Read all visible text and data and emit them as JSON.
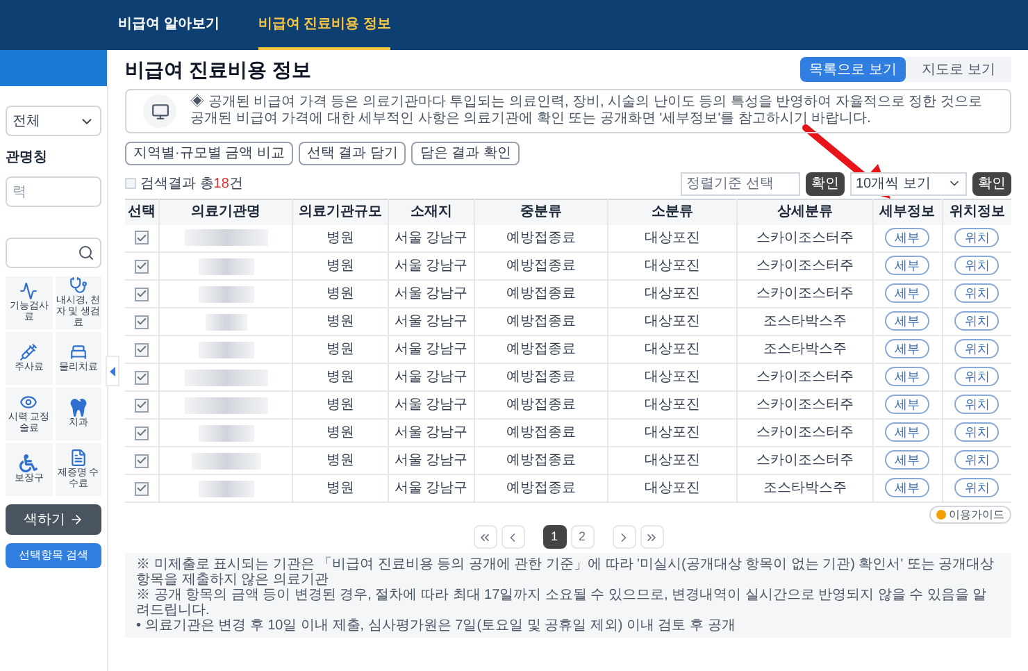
{
  "nav": {
    "tabs": [
      {
        "label": "비급여 알아보기",
        "selected": false
      },
      {
        "label": "비급여 진료비용 정보",
        "selected": true
      }
    ]
  },
  "sidebar": {
    "region_select": "전체",
    "name_label": "관명칭",
    "name_placeholder": "력",
    "categories": [
      {
        "label": "기능검사료",
        "kind": "pulse"
      },
      {
        "label": "내시경, 천자 및 생검료",
        "kind": "stethoscope"
      },
      {
        "label": "주사료",
        "kind": "syringe"
      },
      {
        "label": "물리치료",
        "kind": "bed"
      },
      {
        "label": "시력 교정술료",
        "kind": "eye"
      },
      {
        "label": "치과",
        "kind": "tooth"
      },
      {
        "label": "보장구",
        "kind": "wheelchair"
      },
      {
        "label": "제증명 수수료",
        "kind": "document"
      }
    ],
    "search_button": "색하기",
    "selected_search_button": "선택항목 검색"
  },
  "page": {
    "title": "비급여 진료비용 정보",
    "view_tabs": [
      {
        "label": "목록으로 보기",
        "selected": true
      },
      {
        "label": "지도로 보기",
        "selected": false
      }
    ],
    "notice": "◈ 공개된 비급여 가격 등은 의료기관마다 투입되는 의료인력, 장비, 시술의 난이도 등의 특성을 반영하여 자율적으로 정한 것으로 공개된 비급여 가격에 대한 세부적인 사항은 의료기관에 확인 또는 공개화면 '세부정보'를 참고하시기 바랍니다.",
    "actions": [
      "지역별·규모별 금액 비교",
      "선택 결과 담기",
      "담은 결과 확인"
    ],
    "result": {
      "prefix": "검색결과 총",
      "count": "18",
      "suffix": "건"
    },
    "sort_select": {
      "placeholder": "정렬기준 선택"
    },
    "sort_confirm": "확인",
    "page_size_select": "10개씩 보기",
    "page_size_confirm": "확인"
  },
  "table": {
    "columns": [
      "선택",
      "의료기관명",
      "의료기관규모",
      "소재지",
      "중분류",
      "소분류",
      "상세분류",
      "세부정보",
      "위치정보"
    ],
    "rows": [
      {
        "checked": true,
        "size": "병원",
        "location": "서울 강남구",
        "mid": "예방접종료",
        "sub": "대상포진",
        "detail": "스카이조스터주",
        "detail_button": "세부",
        "location_button": "위치"
      },
      {
        "checked": true,
        "size": "병원",
        "location": "서울 강남구",
        "mid": "예방접종료",
        "sub": "대상포진",
        "detail": "스카이조스터주",
        "detail_button": "세부",
        "location_button": "위치"
      },
      {
        "checked": true,
        "size": "병원",
        "location": "서울 강남구",
        "mid": "예방접종료",
        "sub": "대상포진",
        "detail": "스카이조스터주",
        "detail_button": "세부",
        "location_button": "위치"
      },
      {
        "checked": true,
        "size": "병원",
        "location": "서울 강남구",
        "mid": "예방접종료",
        "sub": "대상포진",
        "detail": "조스타박스주",
        "detail_button": "세부",
        "location_button": "위치"
      },
      {
        "checked": true,
        "size": "병원",
        "location": "서울 강남구",
        "mid": "예방접종료",
        "sub": "대상포진",
        "detail": "조스타박스주",
        "detail_button": "세부",
        "location_button": "위치"
      },
      {
        "checked": true,
        "size": "병원",
        "location": "서울 강남구",
        "mid": "예방접종료",
        "sub": "대상포진",
        "detail": "스카이조스터주",
        "detail_button": "세부",
        "location_button": "위치"
      },
      {
        "checked": true,
        "size": "병원",
        "location": "서울 강남구",
        "mid": "예방접종료",
        "sub": "대상포진",
        "detail": "스카이조스터주",
        "detail_button": "세부",
        "location_button": "위치"
      },
      {
        "checked": true,
        "size": "병원",
        "location": "서울 강남구",
        "mid": "예방접종료",
        "sub": "대상포진",
        "detail": "스카이조스터주",
        "detail_button": "세부",
        "location_button": "위치"
      },
      {
        "checked": true,
        "size": "병원",
        "location": "서울 강남구",
        "mid": "예방접종료",
        "sub": "대상포진",
        "detail": "스카이조스터주",
        "detail_button": "세부",
        "location_button": "위치"
      },
      {
        "checked": true,
        "size": "병원",
        "location": "서울 강남구",
        "mid": "예방접종료",
        "sub": "대상포진",
        "detail": "조스타박스주",
        "detail_button": "세부",
        "location_button": "위치"
      }
    ]
  },
  "guide": "이용가이드",
  "pagination": {
    "pages": [
      {
        "label": "1",
        "selected": true
      },
      {
        "label": "2",
        "selected": false
      }
    ]
  },
  "footnotes": [
    "※ 미제출로 표시되는 기관은 「비급여 진료비용 등의 공개에 관한 기준」에 따라 '미실시(공개대상 항목이 없는 기관) 확인서' 또는 공개대상 항목을 제출하지 않은 의료기관",
    "※ 공개 항목의 금액 등이 변경된 경우, 절차에 따라 최대 17일까지 소요될 수 있으므로, 변경내역이 실시간으로 반영되지 않을 수 있음을 알려드립니다.",
    "• 의료기관은 변경 후 10일 이내 제출, 심사평가원은 7일(토요일 및 공휴일 제외) 이내 검토 후 공개"
  ]
}
